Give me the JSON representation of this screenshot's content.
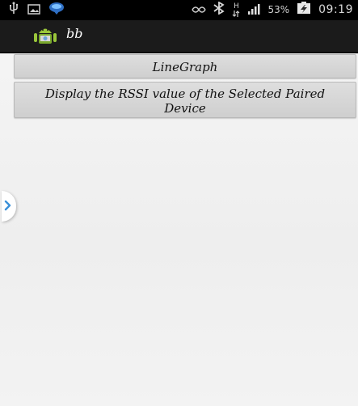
{
  "status_bar": {
    "battery_percent": "53%",
    "time": "09:19",
    "network_type": "H",
    "icons": [
      "usb-icon",
      "screenshot-icon",
      "app-notification-icon",
      "nfc-icon",
      "bluetooth-icon",
      "data-transfer-icon",
      "signal-icon",
      "battery-icon"
    ]
  },
  "action_bar": {
    "title": "bb",
    "icon": "android-robot-icon"
  },
  "buttons": {
    "line_graph": "LineGraph",
    "rssi": "Display the RSSI value of the Selected Paired Device"
  },
  "side_handle": {
    "icon": "chevron-right-icon"
  },
  "colors": {
    "status_bar": "#000000",
    "action_bar": "#1b1b1b",
    "button": "#d6d6d6",
    "background": "#f2f2f2",
    "android_green": "#9ac63b",
    "bluetooth_blue": "#3a7fd0"
  }
}
